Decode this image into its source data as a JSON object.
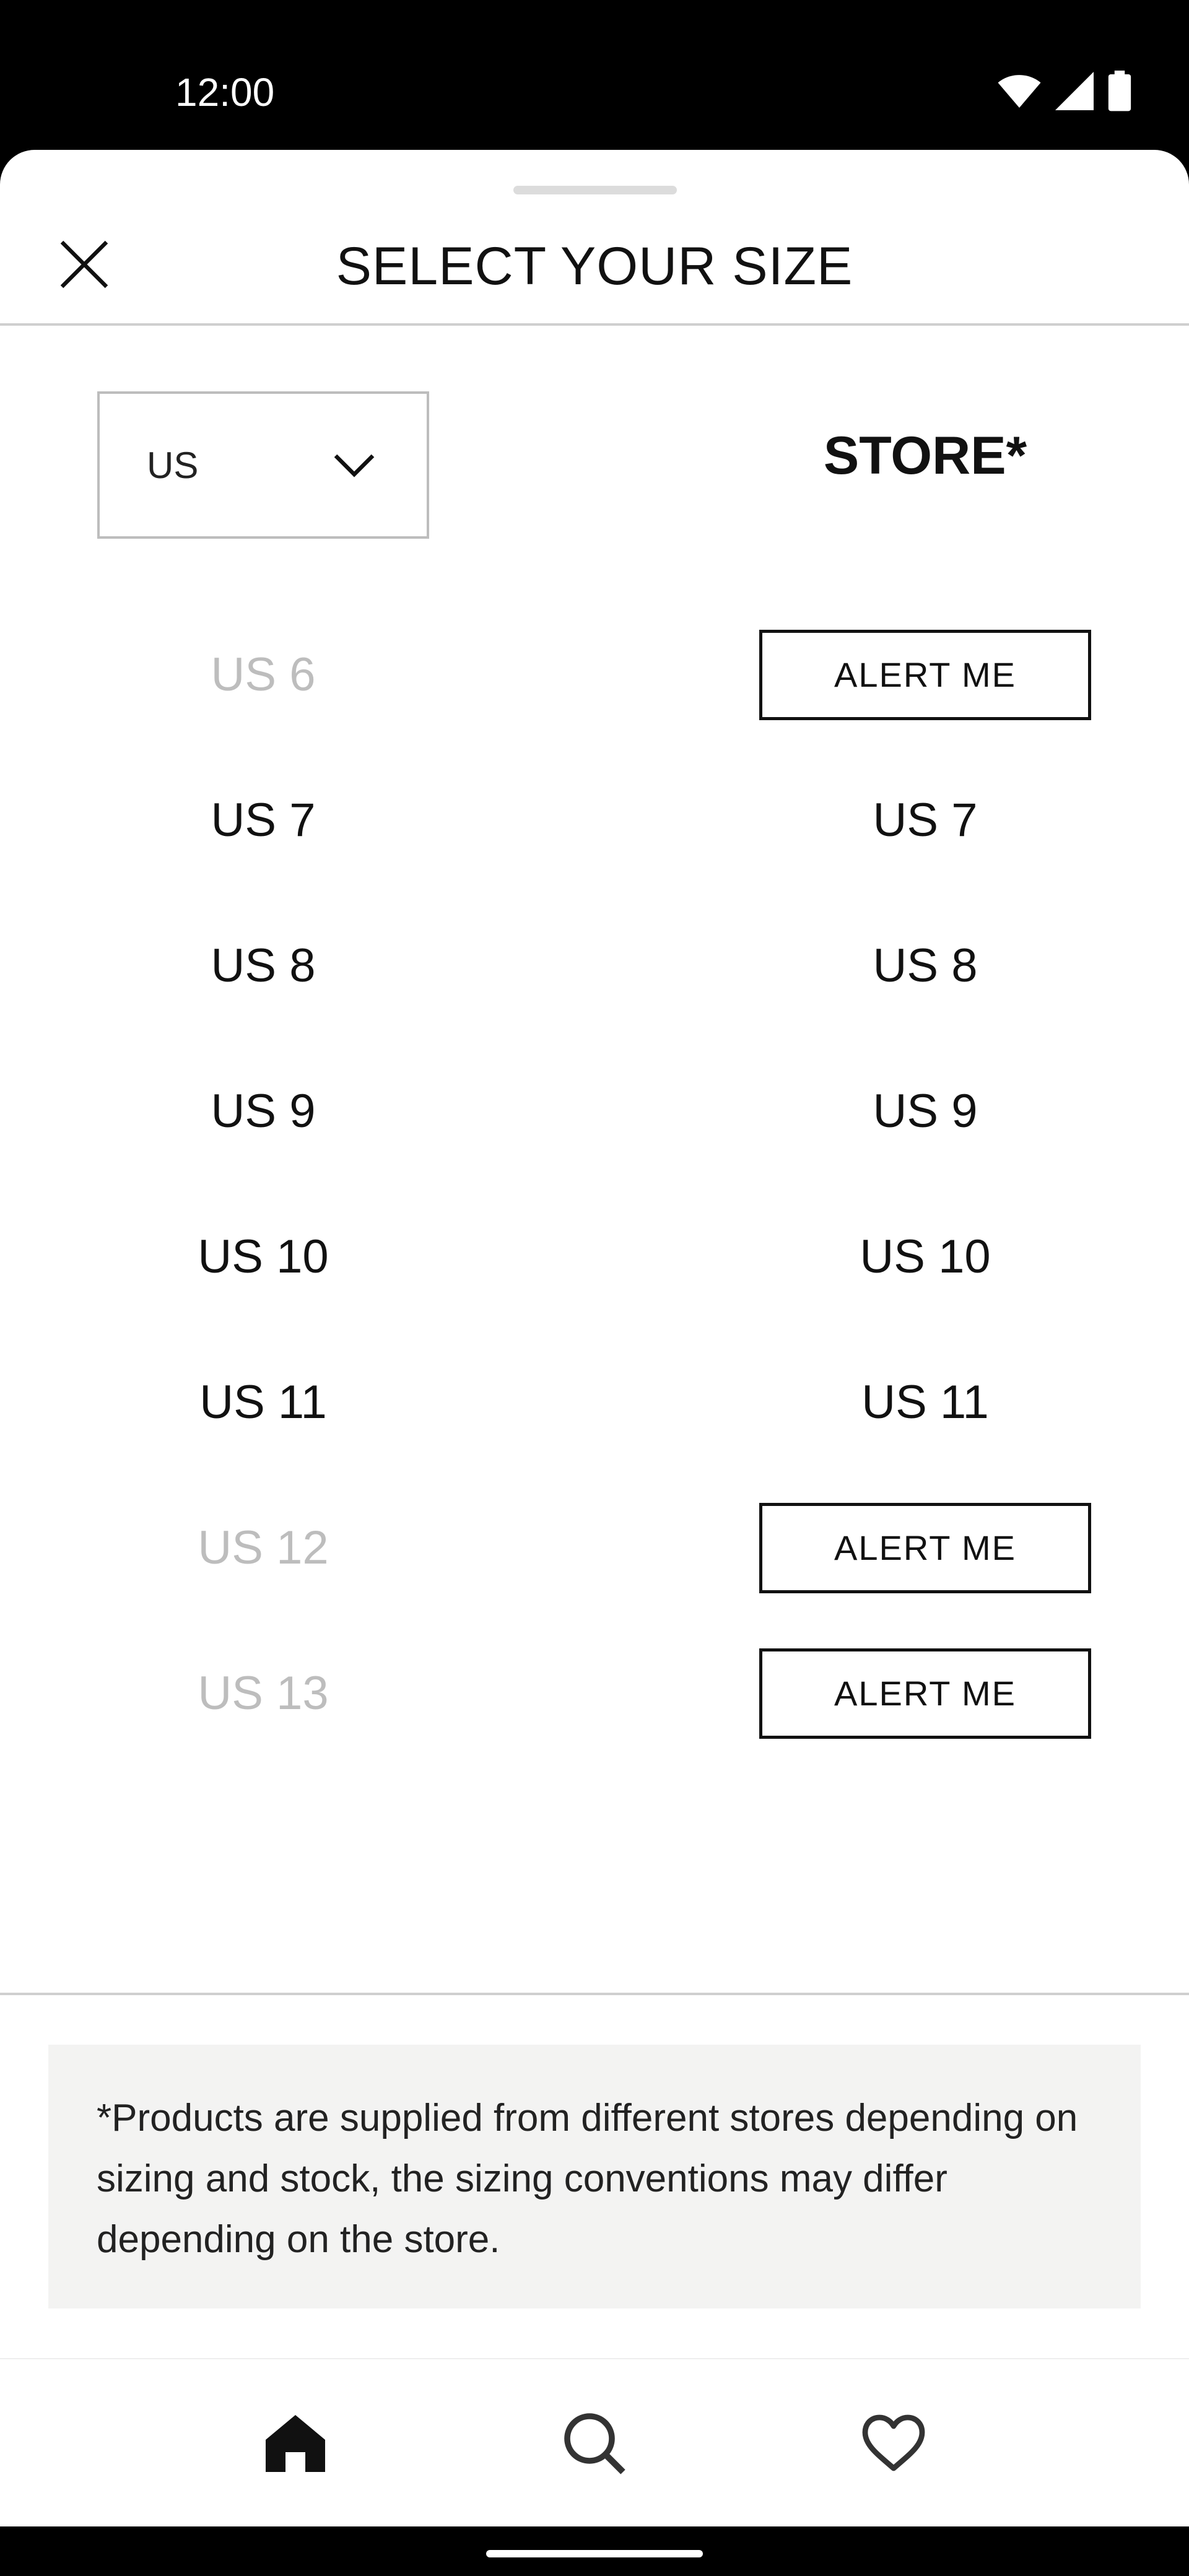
{
  "status_bar": {
    "time": "12:00",
    "icons": [
      "wifi-icon",
      "signal-icon",
      "battery-icon"
    ]
  },
  "sheet": {
    "title": "SELECT YOUR SIZE",
    "close_icon": "close-icon"
  },
  "region_select": {
    "value": "US",
    "icon": "chevron-down-icon"
  },
  "store_header": "STORE*",
  "sizes": [
    {
      "size": "US 6",
      "available": false,
      "store": "ALERT ME"
    },
    {
      "size": "US 7",
      "available": true,
      "store": "US 7"
    },
    {
      "size": "US 8",
      "available": true,
      "store": "US 8"
    },
    {
      "size": "US 9",
      "available": true,
      "store": "US 9"
    },
    {
      "size": "US 10",
      "available": true,
      "store": "US 10"
    },
    {
      "size": "US 11",
      "available": true,
      "store": "US 11"
    },
    {
      "size": "US 12",
      "available": false,
      "store": "ALERT ME"
    },
    {
      "size": "US 13",
      "available": false,
      "store": "ALERT ME"
    }
  ],
  "notice": "*Products are supplied from different stores depending on sizing and stock, the sizing conventions may differ depending on the store.",
  "bottom_nav": [
    {
      "icon": "home-icon",
      "active": true
    },
    {
      "icon": "search-icon",
      "active": false
    },
    {
      "icon": "heart-icon",
      "active": false
    }
  ],
  "colors": {
    "text": "#111111",
    "disabled": "#bdbdbd",
    "notice_bg": "#f3f3f2"
  }
}
